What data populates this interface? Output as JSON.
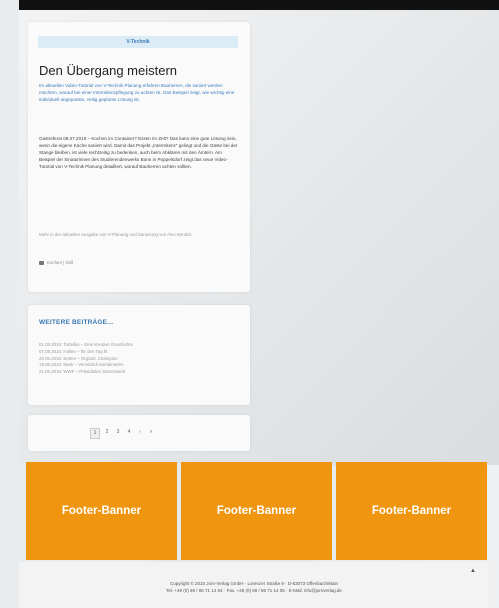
{
  "article": {
    "tag": "V-Technik",
    "title": "Den Übergang meistern",
    "lead": "Im aktuellen Video-Tutorial von V-Technik Planung erfahren Bauherren, die saniert werden möchten, worauf bei einer Intermitenzpflegung zu achten ist. Das Beispiel zeigt, wie wichtig eine individuell angepasste, zeitig geplante Lösung ist.",
    "body": "Gastreferat 08.07.2016 – Kochen im Container? Essen im Zelt? Das kann eine gute Lösung sein, wenn die eigene Küche saniert wird. Damit das Projekt „Intermitenz“ gelingt und die Gäste bei der Stange bleiben, ist viele rechtzeitig zu bedenken, auch beim Abklären mit den Ämtern. Am Beispiel der Sinatorinnen des Studierendenwerks Bonn in Poppelsdorf zeigt das neue Video-Tutorial von V-Technik Planung detailliert, worauf Bauherren achten sollten.",
    "more_note": "Mehr in der aktuellen Ausgabe von V-Planung und Sanierung von Alex Bentich",
    "meta": "Kochen | Grill"
  },
  "more": {
    "title": "WEITERE BEITRÄGE...",
    "items": [
      "01.03.2016: Tortellini – Eine kreative Geschichte",
      "07.08.2016: Hallen – für den Tag fit",
      "20.06.2016: Betten – Organic Champion",
      "19.05.2016: Mark – Vermittlich kombinieren",
      "21.05.2016: WWF – Präsidiales Stammwerk"
    ]
  },
  "pagination": {
    "pages": [
      "1",
      "2",
      "3",
      "4"
    ],
    "next": "›",
    "last": "»"
  },
  "banners": [
    "Footer-Banner",
    "Footer-Banner",
    "Footer-Banner"
  ],
  "footer": {
    "copyright": "Copyright © 2015 Jorn-Verlag GmbH · Lorenzer Straße 9 · D-63073 Offenbach/Main",
    "contact": "Tel. +49 (0) 69 / 86 71 14 04 · Fax. +49 (0) 69 / 86 71 14 06 · E-Mail: info@jornverlag.de",
    "scroll_up": "▲"
  }
}
